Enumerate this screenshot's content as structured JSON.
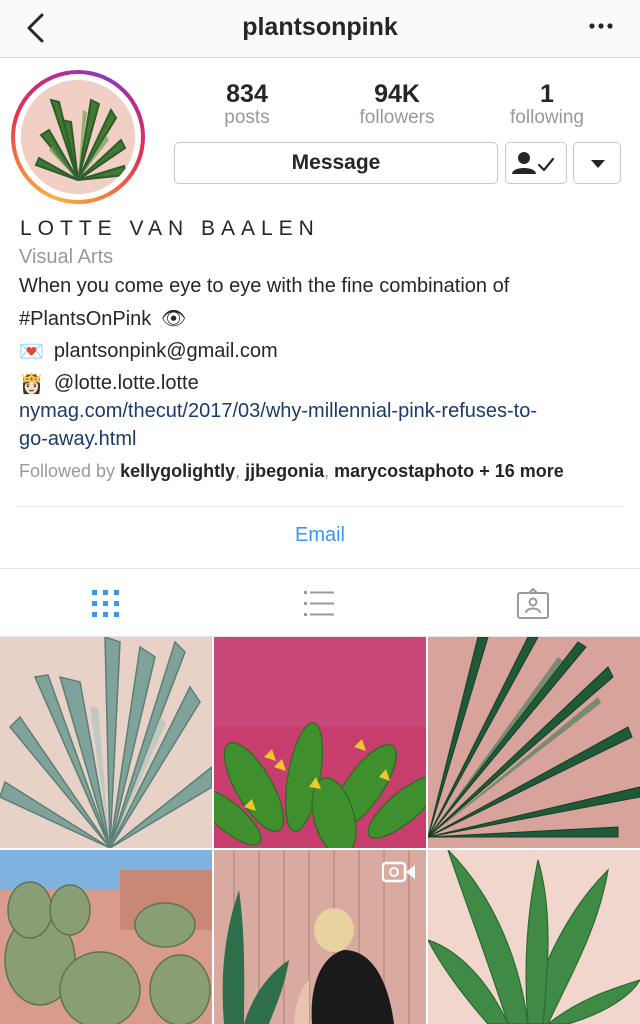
{
  "header": {
    "title": "plantsonpink",
    "back_icon": "chevron-left-icon",
    "more_icon": "more-dots-icon"
  },
  "stats": [
    {
      "value": "834",
      "label": "posts"
    },
    {
      "value": "94K",
      "label": "followers"
    },
    {
      "value": "1",
      "label": "following"
    }
  ],
  "actions": {
    "message_label": "Message",
    "follow_icon": "following-check-icon",
    "dropdown_icon": "caret-down-icon"
  },
  "profile": {
    "name": "LOTTE VAN BAALEN",
    "category": "Visual Arts",
    "bio_line1": "When you come eye to eye with the fine combination of",
    "bio_line2": "#PlantsOnPink",
    "bio_emoji": "👁",
    "email_emoji": "💌",
    "email": "plantsonpink@gmail.com",
    "handle_emoji": "👸🏻",
    "handle": "@lotte.lotte.lotte",
    "link_line1": "nymag.com/thecut/2017/03/why-millennial-pink-refuses-to-",
    "link_line2": "go-away.html",
    "followed_by_prefix": "Followed by ",
    "followed_by_users": [
      "kellygolightly",
      "jjbegonia",
      "marycostaphoto"
    ],
    "followed_by_more": "+ 16 more"
  },
  "email_button": "Email",
  "tabs": [
    "grid-icon",
    "list-icon",
    "tagged-icon"
  ],
  "colors": {
    "accent": "#3897f0",
    "link": "#1c3a6a",
    "muted": "#999999"
  },
  "posts": [
    {
      "desc": "agave plant",
      "video": false
    },
    {
      "desc": "heliconia on pink wall",
      "video": false
    },
    {
      "desc": "palm leaf shadow",
      "video": false
    },
    {
      "desc": "prickly pear cactus",
      "video": false
    },
    {
      "desc": "woman by plant mural",
      "video": true
    },
    {
      "desc": "tropical leaves",
      "video": false
    }
  ]
}
